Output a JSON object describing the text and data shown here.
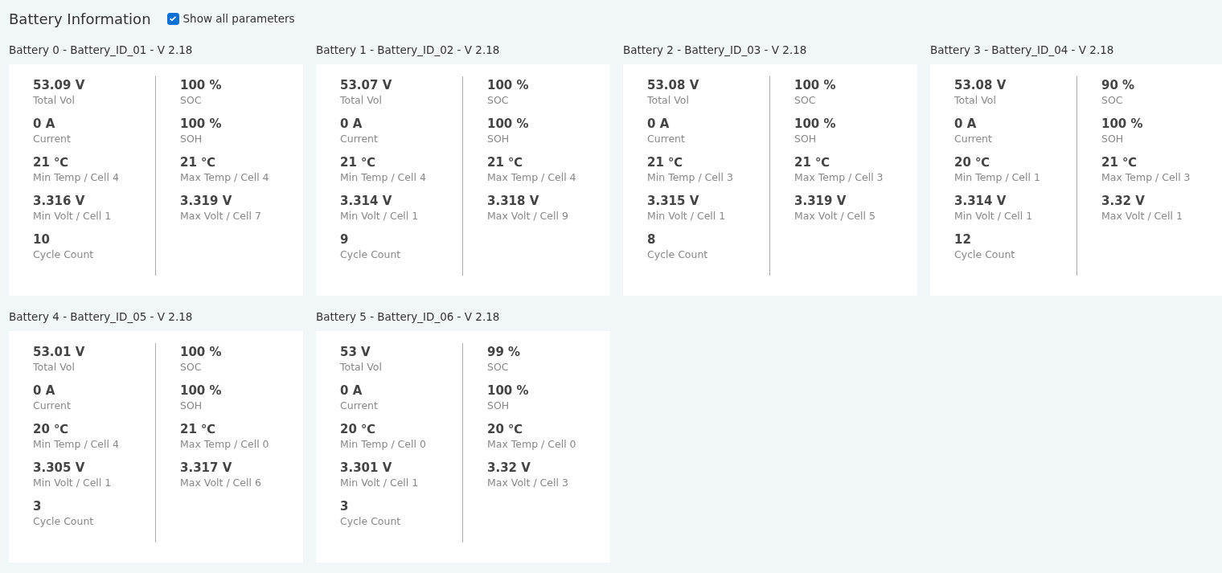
{
  "page": {
    "title": "Battery Information",
    "show_all": {
      "label": "Show all parameters",
      "checked": true
    }
  },
  "batteries": [
    {
      "title": "Battery 0 - Battery_ID_01 - V 2.18",
      "left": [
        {
          "value": "53.09 V",
          "label": "Total Vol"
        },
        {
          "value": "0 A",
          "label": "Current"
        },
        {
          "value": "21 ℃",
          "label": "Min Temp / Cell 4"
        },
        {
          "value": "3.316 V",
          "label": "Min Volt / Cell 1"
        },
        {
          "value": "10",
          "label": "Cycle Count"
        }
      ],
      "right": [
        {
          "value": "100 %",
          "label": "SOC"
        },
        {
          "value": "100 %",
          "label": "SOH"
        },
        {
          "value": "21 ℃",
          "label": "Max Temp / Cell 4"
        },
        {
          "value": "3.319 V",
          "label": "Max Volt / Cell 7"
        }
      ]
    },
    {
      "title": "Battery 1 - Battery_ID_02 - V 2.18",
      "left": [
        {
          "value": "53.07 V",
          "label": "Total Vol"
        },
        {
          "value": "0 A",
          "label": "Current"
        },
        {
          "value": "21 ℃",
          "label": "Min Temp / Cell 4"
        },
        {
          "value": "3.314 V",
          "label": "Min Volt / Cell 1"
        },
        {
          "value": "9",
          "label": "Cycle Count"
        }
      ],
      "right": [
        {
          "value": "100 %",
          "label": "SOC"
        },
        {
          "value": "100 %",
          "label": "SOH"
        },
        {
          "value": "21 ℃",
          "label": "Max Temp / Cell 4"
        },
        {
          "value": "3.318 V",
          "label": "Max Volt / Cell 9"
        }
      ]
    },
    {
      "title": "Battery 2 - Battery_ID_03 - V 2.18",
      "left": [
        {
          "value": "53.08 V",
          "label": "Total Vol"
        },
        {
          "value": "0 A",
          "label": "Current"
        },
        {
          "value": "21 ℃",
          "label": "Min Temp / Cell 3"
        },
        {
          "value": "3.315 V",
          "label": "Min Volt / Cell 1"
        },
        {
          "value": "8",
          "label": "Cycle Count"
        }
      ],
      "right": [
        {
          "value": "100 %",
          "label": "SOC"
        },
        {
          "value": "100 %",
          "label": "SOH"
        },
        {
          "value": "21 ℃",
          "label": "Max Temp / Cell 3"
        },
        {
          "value": "3.319 V",
          "label": "Max Volt / Cell 5"
        }
      ]
    },
    {
      "title": "Battery 3 - Battery_ID_04 - V 2.18",
      "left": [
        {
          "value": "53.08 V",
          "label": "Total Vol"
        },
        {
          "value": "0 A",
          "label": "Current"
        },
        {
          "value": "20 ℃",
          "label": "Min Temp / Cell 1"
        },
        {
          "value": "3.314 V",
          "label": "Min Volt / Cell 1"
        },
        {
          "value": "12",
          "label": "Cycle Count"
        }
      ],
      "right": [
        {
          "value": "90 %",
          "label": "SOC"
        },
        {
          "value": "100 %",
          "label": "SOH"
        },
        {
          "value": "21 ℃",
          "label": "Max Temp / Cell 3"
        },
        {
          "value": "3.32 V",
          "label": "Max Volt / Cell 1"
        }
      ]
    },
    {
      "title": "Battery 4 - Battery_ID_05 - V 2.18",
      "left": [
        {
          "value": "53.01 V",
          "label": "Total Vol"
        },
        {
          "value": "0 A",
          "label": "Current"
        },
        {
          "value": "20 ℃",
          "label": "Min Temp / Cell 4"
        },
        {
          "value": "3.305 V",
          "label": "Min Volt / Cell 1"
        },
        {
          "value": "3",
          "label": "Cycle Count"
        }
      ],
      "right": [
        {
          "value": "100 %",
          "label": "SOC"
        },
        {
          "value": "100 %",
          "label": "SOH"
        },
        {
          "value": "21 ℃",
          "label": "Max Temp / Cell 0"
        },
        {
          "value": "3.317 V",
          "label": "Max Volt / Cell 6"
        }
      ]
    },
    {
      "title": "Battery 5 - Battery_ID_06 - V 2.18",
      "left": [
        {
          "value": "53 V",
          "label": "Total Vol"
        },
        {
          "value": "0 A",
          "label": "Current"
        },
        {
          "value": "20 ℃",
          "label": "Min Temp / Cell 0"
        },
        {
          "value": "3.301 V",
          "label": "Min Volt / Cell 1"
        },
        {
          "value": "3",
          "label": "Cycle Count"
        }
      ],
      "right": [
        {
          "value": "99 %",
          "label": "SOC"
        },
        {
          "value": "100 %",
          "label": "SOH"
        },
        {
          "value": "20 ℃",
          "label": "Max Temp / Cell 0"
        },
        {
          "value": "3.32 V",
          "label": "Max Volt / Cell 3"
        }
      ]
    }
  ]
}
